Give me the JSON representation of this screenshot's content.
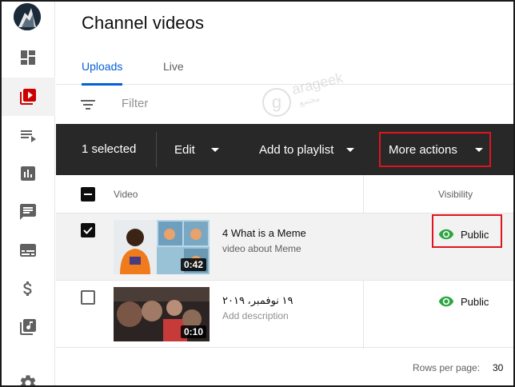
{
  "sidebar": {
    "items": [
      {
        "name": "dashboard-icon"
      },
      {
        "name": "content-icon",
        "active": true
      },
      {
        "name": "playlists-icon"
      },
      {
        "name": "analytics-icon"
      },
      {
        "name": "comments-icon"
      },
      {
        "name": "subtitles-icon"
      },
      {
        "name": "monetization-icon"
      },
      {
        "name": "audio-library-icon"
      },
      {
        "name": "settings-icon"
      }
    ]
  },
  "header": {
    "title": "Channel videos"
  },
  "tabs": [
    {
      "label": "Uploads",
      "active": true
    },
    {
      "label": "Live",
      "active": false
    }
  ],
  "filter": {
    "placeholder": "Filter"
  },
  "watermark": {
    "text": "arageek",
    "sub": "مجتمع"
  },
  "toolbar": {
    "selected_label": "1 selected",
    "edit_label": "Edit",
    "playlist_label": "Add to playlist",
    "more_label": "More actions"
  },
  "table": {
    "headers": {
      "video": "Video",
      "visibility": "Visibility"
    },
    "rows": [
      {
        "title": "4 What is a Meme",
        "description": "video about Meme",
        "duration": "0:42",
        "visibility": "Public",
        "checked": true
      },
      {
        "title": "١٩ نوفمبر، ٢٠١٩",
        "description": "Add description",
        "duration": "0:10",
        "visibility": "Public",
        "checked": false
      }
    ]
  },
  "footer": {
    "rows_per_page_label": "Rows per page:",
    "rows_per_page_value": "30"
  },
  "colors": {
    "accent": "#065fd4",
    "toolbar_bg": "#282828",
    "highlight": "#e0141e",
    "public_icon": "#2ba640",
    "sidebar_active": "#cc0000"
  }
}
